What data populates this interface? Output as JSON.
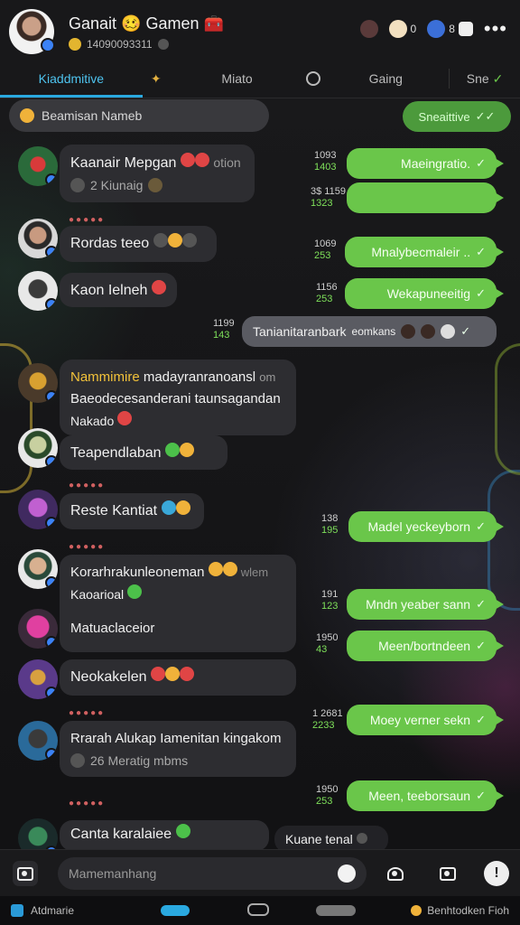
{
  "header": {
    "title": "Ganait 🥴 Gamen 🧰",
    "subtitle": "14090093311",
    "icon_counts": [
      "0",
      "8"
    ],
    "more": "•••"
  },
  "tabs": [
    "Kiaddmitive",
    "Miato",
    "Gaing",
    "Sne"
  ],
  "search": {
    "placeholder": "Beamisan Nameb"
  },
  "green_pill": {
    "label": "Sneaittive"
  },
  "messages_in": [
    {
      "name": "Kaanair Mepgan",
      "extra": "otion",
      "sub": "2 Kiunaig"
    },
    {
      "name": "Rordas teeo"
    },
    {
      "name": "Kaon Ielneh"
    },
    {
      "lead": "Nammimire",
      "name": "madayranranoansl",
      "extra": "om",
      "line2": "Baeodecesanderani taunsagandan",
      "line3": "Nakado"
    },
    {
      "name": "Teapendlaban"
    },
    {
      "name": "Reste Kantiat"
    },
    {
      "name": "Korarhrakunleoneman",
      "extra": "wlem",
      "line2": "Kaoarioal"
    },
    {
      "name": "Matuaclaceior"
    },
    {
      "name": "Neokakelen"
    },
    {
      "name": "Rrarah Alukap Iamenitan kingakom",
      "sub": "26 Meratig mbms"
    },
    {
      "name": "Canta karalaiee"
    }
  ],
  "messages_out": [
    {
      "text": "Maeingratio.",
      "time": [
        "1093",
        "1403"
      ]
    },
    {
      "text": "",
      "time": [
        "3$ 1159",
        "1323"
      ]
    },
    {
      "text": "Mnalybecmaleir ..",
      "time": [
        "1069",
        "253"
      ]
    },
    {
      "text": "Wekapuneeitig",
      "time": [
        "1156",
        "253"
      ]
    },
    {
      "text": "Madel yeckeyborn",
      "time": [
        "138",
        "195"
      ]
    },
    {
      "text": "Mndn yeaber sann",
      "time": [
        "191",
        "123"
      ]
    },
    {
      "text": "Meen/bortndeen",
      "time": [
        "1950",
        "43"
      ]
    },
    {
      "text": "Moey verner sekn",
      "time": [
        "1 2681",
        "2233"
      ]
    },
    {
      "text": "Meen, teeborsaun",
      "time": [
        "1950",
        "253"
      ]
    }
  ],
  "grey_bubble": {
    "text": "Tanianitaranbark",
    "emph": "eomkans",
    "time": [
      "1199",
      "143"
    ]
  },
  "dark_float": {
    "text": "Kuane tenal"
  },
  "input": {
    "placeholder": "Mamemanhang"
  },
  "navbar": {
    "left": "Atdmarie",
    "right": "Benhtodken Fioh"
  },
  "colors": {
    "accent": "#2aa9e0",
    "bubble_out": "#6ac64a",
    "bubble_in": "#2d2d31"
  }
}
